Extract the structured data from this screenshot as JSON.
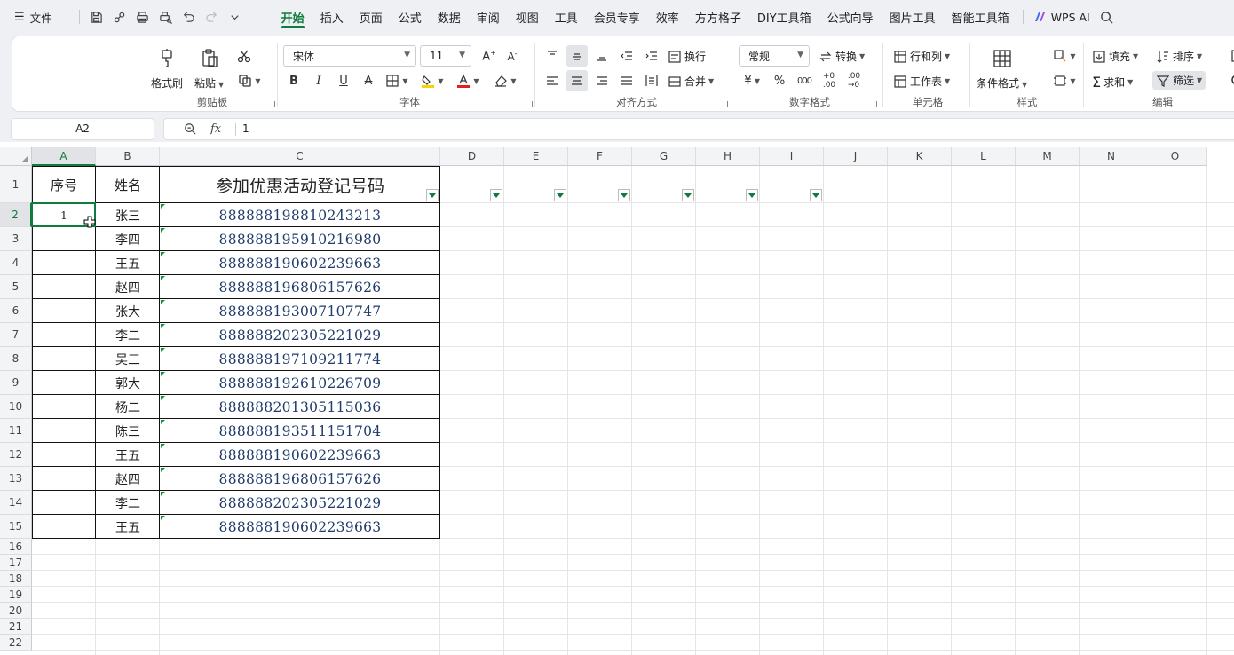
{
  "menu": {
    "file_label": "文件",
    "tabs": [
      "开始",
      "插入",
      "页面",
      "公式",
      "数据",
      "审阅",
      "视图",
      "工具",
      "会员专享",
      "效率",
      "方方格子",
      "DIY工具箱",
      "公式向导",
      "图片工具",
      "智能工具箱"
    ],
    "active_tab": "开始",
    "wps_ai": "WPS AI"
  },
  "ribbon": {
    "clipboard": {
      "label": "剪贴板",
      "format_painter": "格式刷",
      "paste": "粘贴"
    },
    "font": {
      "label": "字体",
      "font_name": "宋体",
      "font_size": "11"
    },
    "align": {
      "label": "对齐方式",
      "wrap": "换行",
      "merge": "合并"
    },
    "number": {
      "label": "数字格式",
      "format": "常规",
      "convert": "转换"
    },
    "cells": {
      "label": "单元格",
      "row_col": "行和列",
      "worksheet": "工作表"
    },
    "styles": {
      "label": "样式",
      "conditional": "条件格式"
    },
    "edit": {
      "label": "编辑",
      "fill": "填充",
      "sort": "排序",
      "sum": "求和",
      "filter": "筛选"
    }
  },
  "formula_bar": {
    "name_box": "A2",
    "fx": "fx",
    "value": "1"
  },
  "sheet": {
    "columns": [
      "A",
      "B",
      "C",
      "D",
      "E",
      "F",
      "G",
      "H",
      "I",
      "J",
      "K",
      "L",
      "M",
      "N",
      "O"
    ],
    "rows": [
      "1",
      "2",
      "3",
      "4",
      "5",
      "6",
      "7",
      "8",
      "9",
      "10",
      "11",
      "12",
      "13",
      "14",
      "15",
      "16",
      "17",
      "18",
      "19",
      "20",
      "21",
      "22"
    ],
    "headers": {
      "seq": "序号",
      "name": "姓名",
      "code": "参加优惠活动登记号码"
    },
    "data": [
      {
        "seq": "1",
        "name": "张三",
        "code": "888888198810243213"
      },
      {
        "seq": "",
        "name": "李四",
        "code": "888888195910216980"
      },
      {
        "seq": "",
        "name": "王五",
        "code": "888888190602239663"
      },
      {
        "seq": "",
        "name": "赵四",
        "code": "888888196806157626"
      },
      {
        "seq": "",
        "name": "张大",
        "code": "888888193007107747"
      },
      {
        "seq": "",
        "name": "李二",
        "code": "888888202305221029"
      },
      {
        "seq": "",
        "name": "吴三",
        "code": "888888197109211774"
      },
      {
        "seq": "",
        "name": "郭大",
        "code": "888888192610226709"
      },
      {
        "seq": "",
        "name": "杨二",
        "code": "888888201305115036"
      },
      {
        "seq": "",
        "name": "陈三",
        "code": "888888193511151704"
      },
      {
        "seq": "",
        "name": "王五",
        "code": "888888190602239663"
      },
      {
        "seq": "",
        "name": "赵四",
        "code": "888888196806157626"
      },
      {
        "seq": "",
        "name": "李二",
        "code": "888888202305221029"
      },
      {
        "seq": "",
        "name": "王五",
        "code": "888888190602239663"
      }
    ],
    "active_cell": "A2"
  }
}
